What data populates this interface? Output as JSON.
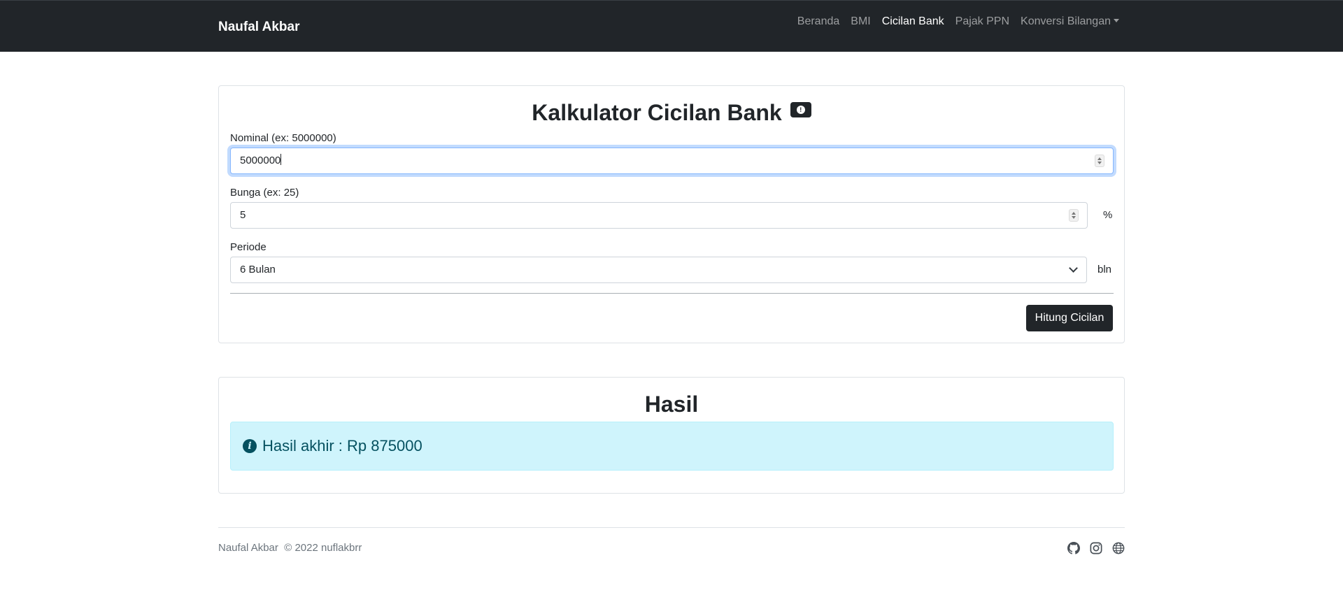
{
  "navbar": {
    "brand": "Naufal Akbar",
    "links": [
      "Beranda",
      "BMI",
      "Cicilan Bank",
      "Pajak PPN",
      "Konversi Bilangan"
    ],
    "active": "Cicilan Bank"
  },
  "form": {
    "title": "Kalkulator Cicilan Bank",
    "nominal_label": "Nominal (ex: 5000000)",
    "nominal_value": "5000000",
    "bunga_label": "Bunga (ex: 25)",
    "bunga_value": "5",
    "bunga_suffix": "%",
    "periode_label": "Periode",
    "periode_value": "6 Bulan",
    "periode_suffix": "bln",
    "submit_label": "Hitung Cicilan"
  },
  "result": {
    "title": "Hasil",
    "text": "Hasil akhir : Rp 875000"
  },
  "footer": {
    "name": "Naufal Akbar",
    "copyright": "© 2022 nuflakbrr",
    "icons": [
      "github-icon",
      "instagram-icon",
      "globe-icon"
    ]
  },
  "colors": {
    "navbar_bg": "#212529",
    "alert_bg": "#cff4fc",
    "alert_text": "#055160",
    "focus_border": "#86b7fe"
  }
}
